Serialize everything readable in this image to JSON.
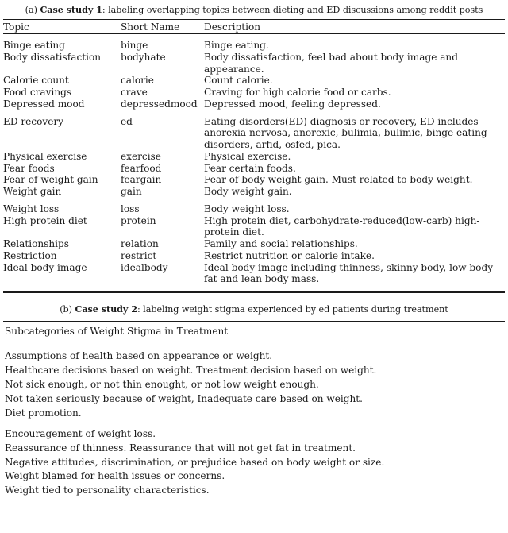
{
  "table_a": {
    "caption_prefix": "(a) ",
    "caption_bold": "Case study 1",
    "caption_rest": ": labeling overlapping topics between dieting and ED discussions among reddit posts",
    "columns": [
      "Topic",
      "Short Name",
      "Description"
    ],
    "groups": [
      {
        "rows": [
          {
            "topic": "Binge eating",
            "short": "binge",
            "desc": "Binge eating."
          },
          {
            "topic": "Body dissatisfaction",
            "short": "bodyhate",
            "desc": "Body dissatisfaction, feel bad about body image and appearance."
          },
          {
            "topic": "Calorie count",
            "short": "calorie",
            "desc": "Count calorie."
          },
          {
            "topic": "Food cravings",
            "short": "crave",
            "desc": "Craving for high calorie food or carbs."
          },
          {
            "topic": "Depressed mood",
            "short": "depressedmood",
            "desc": "Depressed mood, feeling depressed."
          }
        ]
      },
      {
        "rows": [
          {
            "topic": "ED recovery",
            "short": "ed",
            "desc": "Eating disorders(ED) diagnosis or recovery, ED includes anorexia nervosa, anorexic, bulimia, bulimic, binge eating disorders, arfid, osfed, pica."
          },
          {
            "topic": "Physical exercise",
            "short": "exercise",
            "desc": "Physical exercise."
          },
          {
            "topic": "Fear foods",
            "short": "fearfood",
            "desc": "Fear certain foods."
          },
          {
            "topic": "Fear of weight gain",
            "short": "feargain",
            "desc": "Fear of body weight gain. Must related to body weight."
          },
          {
            "topic": "Weight gain",
            "short": "gain",
            "desc": "Body weight gain."
          }
        ]
      },
      {
        "rows": [
          {
            "topic": "Weight loss",
            "short": "loss",
            "desc": "Body weight loss."
          },
          {
            "topic": "High protein diet",
            "short": "protein",
            "desc": "High protein diet, carbohydrate-reduced(low-carb) high-protein diet."
          },
          {
            "topic": "Relationships",
            "short": "relation",
            "desc": "Family and social relationships."
          },
          {
            "topic": "Restriction",
            "short": "restrict",
            "desc": "Restrict nutrition or calorie intake."
          },
          {
            "topic": "Ideal body image",
            "short": "idealbody",
            "desc": "Ideal body image including thinness, skinny body, low body fat and lean body mass."
          }
        ]
      }
    ]
  },
  "table_b": {
    "caption_prefix": "(b) ",
    "caption_bold": "Case study 2",
    "caption_rest": ": labeling weight stigma experienced by ed patients during treatment",
    "column": "Subcategories of Weight Stigma in Treatment",
    "groups": [
      {
        "rows": [
          "Assumptions of health based on appearance or weight.",
          "Healthcare decisions based on weight. Treatment decision based on weight.",
          "Not sick enough, or not thin enought, or not low weight enough.",
          "Not taken seriously because of weight, Inadequate care based on weight.",
          "Diet promotion."
        ]
      },
      {
        "rows": [
          "Encouragement of weight loss.",
          "Reassurance of thinness. Reassurance that will not get fat in treatment.",
          "Negative attitudes, discrimination, or prejudice based on body weight or size.",
          "Weight blamed for health issues or concerns.",
          "Weight tied to personality characteristics."
        ]
      }
    ]
  }
}
